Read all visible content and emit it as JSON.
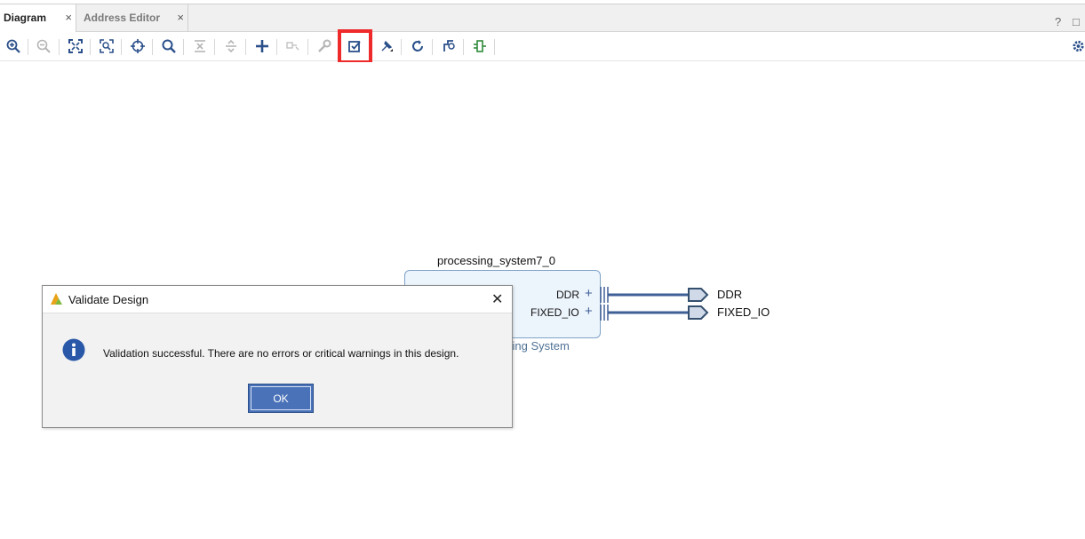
{
  "tabs": [
    {
      "label": "Diagram",
      "active": true
    },
    {
      "label": "Address Editor",
      "active": false
    }
  ],
  "tab_close_glyph": "×",
  "window_controls": {
    "help": "?",
    "maximize": "□"
  },
  "toolbar": {
    "highlighted_tool": "validate-design-button",
    "highlight_color": "#ee2a2a",
    "tools": [
      "zoom-in-icon",
      "zoom-out-icon",
      "zoom-fit-icon",
      "zoom-area-icon",
      "center-icon",
      "search-icon",
      "collapse-all-icon",
      "expand-all-icon",
      "add-ip-icon",
      "make-external-icon",
      "properties-icon",
      "validate-design-icon",
      "auto-connect-icon",
      "regenerate-layout-icon",
      "optimize-routing-icon",
      "interface-icon",
      "settings-icon"
    ]
  },
  "diagram": {
    "ip_instance_name": "processing_system7_0",
    "ip_subtitle": "sing System",
    "ports": [
      {
        "label": "DDR",
        "expander": "+"
      },
      {
        "label": "FIXED_IO",
        "expander": "+"
      }
    ],
    "external_ports": [
      "DDR",
      "FIXED_IO"
    ],
    "wire_color": "#3f5f97"
  },
  "dialog": {
    "title": "Validate Design",
    "message": "Validation successful. There are no errors or critical warnings in this design.",
    "ok_label": "OK",
    "close_glyph": "✕",
    "info_icon_color": "#2a58a8"
  }
}
